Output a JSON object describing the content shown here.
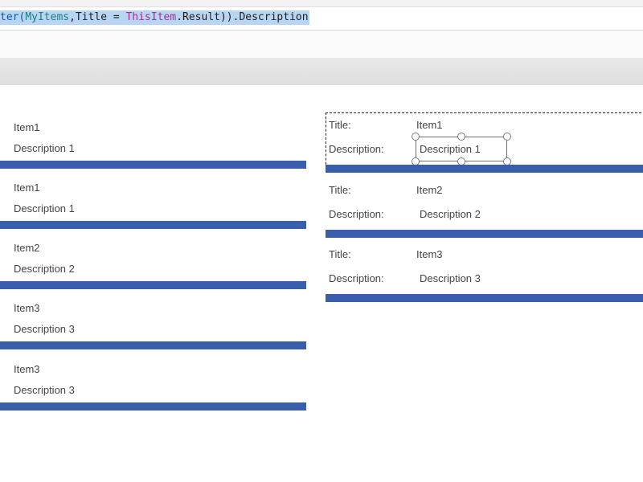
{
  "formula": {
    "t1": "ter(",
    "t2": "MyItems",
    "t3": ",Title = ",
    "t4": "ThisItem",
    "t5": ".Result)).Description"
  },
  "left_gallery": {
    "items": [
      {
        "title": "Item1",
        "description": "Description 1"
      },
      {
        "title": "Item1",
        "description": "Description 1"
      },
      {
        "title": "Item2",
        "description": "Description 2"
      },
      {
        "title": "Item3",
        "description": "Description 3"
      },
      {
        "title": "Item3",
        "description": "Description 3"
      }
    ]
  },
  "right_gallery": {
    "title_label": "Title:",
    "description_label": "Description:",
    "items": [
      {
        "title": "Item1",
        "description": "Description 1"
      },
      {
        "title": "Item2",
        "description": "Description 2"
      },
      {
        "title": "Item3",
        "description": "Description 3"
      }
    ]
  },
  "colors": {
    "separator": "#3a5eae",
    "selection_highlight": "#b8d6f3"
  }
}
